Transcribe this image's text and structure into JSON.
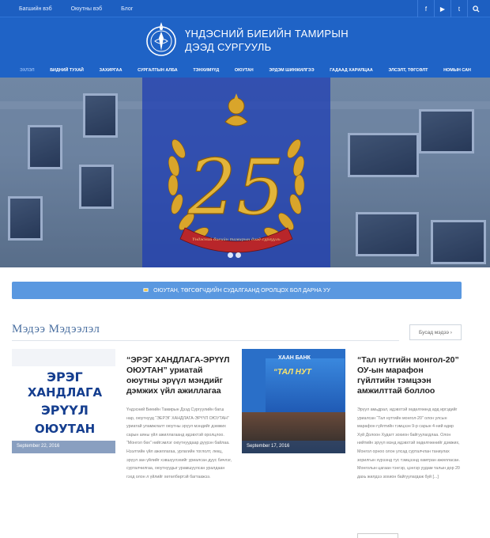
{
  "topbar": {
    "links": [
      "Багшийн вэб",
      "Оюутны вэб",
      "Блог"
    ],
    "social_icons": [
      "facebook-icon",
      "youtube-icon",
      "twitter-icon",
      "search-icon"
    ]
  },
  "header": {
    "title_line1": "ҮНДЭСНИЙ БИЕИЙН ТАМИРЫН",
    "title_line2": "ДЭЭД СУРГУУЛЬ",
    "logo_text": "ҮБТДС"
  },
  "nav": {
    "items": [
      {
        "label": "ЭХЛЭЛ",
        "active": true
      },
      {
        "label": "БИДНИЙ ТУХАЙ",
        "active": false
      },
      {
        "label": "ЗАХИРГАА",
        "active": false
      },
      {
        "label": "СУРГАЛТЫН АЛБА",
        "active": false
      },
      {
        "label": "ТЭНХИМҮҮД",
        "active": false
      },
      {
        "label": "ОЮУТАН",
        "active": false
      },
      {
        "label": "ЭРДЭМ ШИНЖИЛГЭЭ",
        "active": false
      },
      {
        "label": "ГАДААД ХАРИЛЦАА",
        "active": false
      },
      {
        "label": "ЭЛСЭЛТ, ТӨГСӨЛТ",
        "active": false
      },
      {
        "label": "НОМЫН САН",
        "active": false
      }
    ]
  },
  "hero": {
    "emblem_number": "25",
    "ribbon_text": "Үндэсний биеийн тамирын дээд сургууль",
    "slides": 2,
    "active_slide": 1
  },
  "announcement": {
    "text": "ОЮУТАН, ТӨГСӨГЧДИЙН СУДАЛГААНД ОРОЛЦОХ БОЛ ДАРНА УУ"
  },
  "news": {
    "section_title": "Мэдээ Мэдээлэл",
    "more_label": "Бусад мэдээ ›",
    "items": [
      {
        "image_lines": [
          "ЭРЭГ",
          "ХАНДЛАГА",
          "ЭРҮҮЛ",
          "ОЮУТАН"
        ],
        "date": "September 22, 2016",
        "title": "“ЭРЭГ ХАНДЛАГА-ЭРҮҮЛ ОЮУТАН” уриатай оюутны эрүүл мэндийг дэмжих үйл ажиллагаа",
        "excerpt": "Үндэсний Биеийн Тамирын Дээд Сургуулийн багш нар, оюутнууд “ЭЕРЭГ ХАНДЛАГА-ЭРҮҮЛ ОЮУТАН” уриатай уламжлалт оюутны эрүүл мэндийг дэмжих сарын аяны үйл ажиллагаанд идэвхтэй оролцлоо. “Монгол бөх” нийгэмлэг оюутнуудаар дүүрэн байлаа. Нээлтийн үйл ажиллагаа, урлагийн тоглолт, лекц, эрүүл зан үйлийг хэвшүүлэхийг уриалсан дуус бичлэг, сурталчилгаа, оюутнуудыг урамшуулсан уралдаан гэхд олон л үйлийг хөтөлбөртэй багтаажээ."
      },
      {
        "image_bank": "ХААН БАНК",
        "image_tag": "“ТАЛ НУТ",
        "date": "September 17, 2016",
        "title": "“Тал нутгийн монгол-20” ОУ-ын марафон гүйлтийн тэмцээн амжилттай боллоо",
        "excerpt": "Эрүүл амьдрал, идэвхтэй хөдөлгөөнд ард иргэдийг уриалсан “Тал нутгийн монгол-20” олон улсын марафон гүйлтийн тэмцээн 9-р сарын 4-ний өдөр Хүй Долоон Худагт зохион байгуулагдлаа. Олон нийтийн эрүүл мэнд идэвхтэй хөдөлгөөнийг дэмжих, Монгол орноо олон улсад сурталчлан таниулах зорилгын хүрээнд тус тэмцээнд хамтран ажилласан. Монголын цагаан тэнгэр, цэнгэр уудам талын дор 20 дахь жилдээ зохион байгуулагдаж буй [...]"
      }
    ]
  },
  "colors": {
    "primary": "#1f63c6",
    "topbar": "#1d5fc1",
    "announce": "#5a98e0",
    "section_title": "#4a6fa0"
  }
}
